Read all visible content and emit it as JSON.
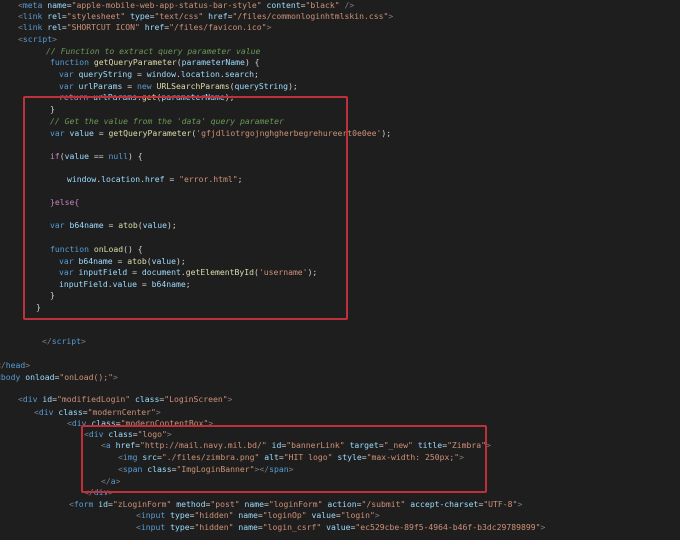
{
  "colors": {
    "background": "#1e1e1e",
    "tag": "#569cd6",
    "attribute": "#9cdcfe",
    "string": "#ce9178",
    "comment": "#6a9955",
    "keyword": "#569cd6",
    "control": "#c586c0",
    "function": "#dcdcaa",
    "highlight_border": "#c0303a"
  },
  "code_lines": [
    [
      [
        "<",
        "punct"
      ],
      [
        "meta ",
        "tag"
      ],
      [
        "name",
        "attr"
      ],
      [
        "=",
        "text"
      ],
      [
        "\"apple-mobile-web-app-status-bar-style\"",
        "str"
      ],
      [
        " ",
        "text"
      ],
      [
        "content",
        "attr"
      ],
      [
        "=",
        "text"
      ],
      [
        "\"black\"",
        "str"
      ],
      [
        " />",
        "punct"
      ]
    ],
    [
      [
        "<",
        "punct"
      ],
      [
        "link ",
        "tag"
      ],
      [
        "rel",
        "attr"
      ],
      [
        "=",
        "text"
      ],
      [
        "\"stylesheet\"",
        "str"
      ],
      [
        " ",
        "text"
      ],
      [
        "type",
        "attr"
      ],
      [
        "=",
        "text"
      ],
      [
        "\"text/css\"",
        "str"
      ],
      [
        " ",
        "text"
      ],
      [
        "href",
        "attr"
      ],
      [
        "=",
        "text"
      ],
      [
        "\"/files/commonloginhtmlskin.css\"",
        "str"
      ],
      [
        ">",
        "punct"
      ]
    ],
    [
      [
        "<",
        "punct"
      ],
      [
        "link ",
        "tag"
      ],
      [
        "rel",
        "attr"
      ],
      [
        "=",
        "text"
      ],
      [
        "\"SHORTCUT ICON\"",
        "str"
      ],
      [
        " ",
        "text"
      ],
      [
        "href",
        "attr"
      ],
      [
        "=",
        "text"
      ],
      [
        "\"/files/favicon.ico\"",
        "str"
      ],
      [
        ">",
        "punct"
      ]
    ],
    [
      [
        "<",
        "punct"
      ],
      [
        "script",
        "tag"
      ],
      [
        ">",
        "punct"
      ]
    ],
    [
      [
        "// Function to extract query parameter value",
        "com"
      ]
    ],
    [
      [
        "function ",
        "kw"
      ],
      [
        "getQueryParameter",
        "fn"
      ],
      [
        "(",
        "plain"
      ],
      [
        "parameterName",
        "var"
      ],
      [
        ") {",
        "plain"
      ]
    ],
    [
      [
        "var ",
        "kw"
      ],
      [
        "queryString",
        "var"
      ],
      [
        " = ",
        "plain"
      ],
      [
        "window",
        "var"
      ],
      [
        ".",
        "plain"
      ],
      [
        "location",
        "var"
      ],
      [
        ".",
        "plain"
      ],
      [
        "search",
        "var"
      ],
      [
        ";",
        "plain"
      ]
    ],
    [
      [
        "var ",
        "kw"
      ],
      [
        "urlParams",
        "var"
      ],
      [
        " = ",
        "plain"
      ],
      [
        "new ",
        "kw"
      ],
      [
        "URLSearchParams",
        "fn"
      ],
      [
        "(",
        "plain"
      ],
      [
        "queryString",
        "var"
      ],
      [
        ");",
        "plain"
      ]
    ],
    [
      [
        "return ",
        "ctrl"
      ],
      [
        "urlParams",
        "var"
      ],
      [
        ".",
        "plain"
      ],
      [
        "get",
        "fn"
      ],
      [
        "(",
        "plain"
      ],
      [
        "parameterName",
        "var"
      ],
      [
        ");",
        "plain"
      ]
    ],
    [
      [
        "}",
        "plain"
      ]
    ],
    [
      [
        "// Get the value from the 'data' query parameter",
        "com"
      ]
    ],
    [
      [
        "var ",
        "kw"
      ],
      [
        "value",
        "var"
      ],
      [
        " = ",
        "plain"
      ],
      [
        "getQueryParameter",
        "fn"
      ],
      [
        "(",
        "plain"
      ],
      [
        "'gfjdliotrgojnghgherbegrehureert0e0ee'",
        "str"
      ],
      [
        ");",
        "plain"
      ]
    ],
    [
      [
        "if",
        "ctrl"
      ],
      [
        "(",
        "plain"
      ],
      [
        "value",
        "var"
      ],
      [
        " == ",
        "plain"
      ],
      [
        "null",
        "kw"
      ],
      [
        ") {",
        "plain"
      ]
    ],
    [
      [
        "window",
        "var"
      ],
      [
        ".",
        "plain"
      ],
      [
        "location",
        "var"
      ],
      [
        ".",
        "plain"
      ],
      [
        "href",
        "var"
      ],
      [
        " = ",
        "plain"
      ],
      [
        "\"error.html\"",
        "str"
      ],
      [
        ";",
        "plain"
      ]
    ],
    [
      [
        "}else{",
        "ctrl"
      ]
    ],
    [
      [
        "var ",
        "kw"
      ],
      [
        "b64name",
        "var"
      ],
      [
        " = ",
        "plain"
      ],
      [
        "atob",
        "fn"
      ],
      [
        "(",
        "plain"
      ],
      [
        "value",
        "var"
      ],
      [
        ");",
        "plain"
      ]
    ],
    [
      [
        "function ",
        "kw"
      ],
      [
        "onLoad",
        "fn"
      ],
      [
        "() {",
        "plain"
      ]
    ],
    [
      [
        "var ",
        "kw"
      ],
      [
        "b64name",
        "var"
      ],
      [
        " = ",
        "plain"
      ],
      [
        "atob",
        "fn"
      ],
      [
        "(",
        "plain"
      ],
      [
        "value",
        "var"
      ],
      [
        ");",
        "plain"
      ]
    ],
    [
      [
        "var ",
        "kw"
      ],
      [
        "inputField",
        "var"
      ],
      [
        " = ",
        "plain"
      ],
      [
        "document",
        "var"
      ],
      [
        ".",
        "plain"
      ],
      [
        "getElementById",
        "fn"
      ],
      [
        "(",
        "plain"
      ],
      [
        "'username'",
        "str"
      ],
      [
        ");",
        "plain"
      ]
    ],
    [
      [
        "inputField",
        "var"
      ],
      [
        ".",
        "plain"
      ],
      [
        "value",
        "var"
      ],
      [
        " = ",
        "plain"
      ],
      [
        "b64name",
        "var"
      ],
      [
        ";",
        "plain"
      ]
    ],
    [
      [
        "}",
        "plain"
      ]
    ],
    [
      [
        "}",
        "plain"
      ]
    ],
    [
      [
        "</",
        "punct"
      ],
      [
        "script",
        "tag"
      ],
      [
        ">",
        "punct"
      ]
    ],
    [
      [
        "</",
        "punct"
      ],
      [
        "head",
        "tag"
      ],
      [
        ">",
        "punct"
      ]
    ],
    [
      [
        "<",
        "punct"
      ],
      [
        "body ",
        "tag"
      ],
      [
        "onload",
        "attr"
      ],
      [
        "=",
        "text"
      ],
      [
        "\"onLoad();\"",
        "str"
      ],
      [
        ">",
        "punct"
      ]
    ],
    [
      [
        "<",
        "punct"
      ],
      [
        "div ",
        "tag"
      ],
      [
        "id",
        "attr"
      ],
      [
        "=",
        "text"
      ],
      [
        "\"modifiedLogin\"",
        "str"
      ],
      [
        " ",
        "text"
      ],
      [
        "class",
        "attr"
      ],
      [
        "=",
        "text"
      ],
      [
        "\"LoginScreen\"",
        "str"
      ],
      [
        ">",
        "punct"
      ]
    ],
    [
      [
        "<",
        "punct"
      ],
      [
        "div ",
        "tag"
      ],
      [
        "class",
        "attr"
      ],
      [
        "=",
        "text"
      ],
      [
        "\"modernCenter\"",
        "str"
      ],
      [
        ">",
        "punct"
      ]
    ],
    [
      [
        "<",
        "punct"
      ],
      [
        "div ",
        "tag"
      ],
      [
        "class",
        "attr"
      ],
      [
        "=",
        "text"
      ],
      [
        "\"modernContentBox\"",
        "str"
      ],
      [
        ">",
        "punct"
      ]
    ],
    [
      [
        "<",
        "punct"
      ],
      [
        "div ",
        "tag"
      ],
      [
        "class",
        "attr"
      ],
      [
        "=",
        "text"
      ],
      [
        "\"logo\"",
        "str"
      ],
      [
        ">",
        "punct"
      ]
    ],
    [
      [
        "<",
        "punct"
      ],
      [
        "a ",
        "tag"
      ],
      [
        "href",
        "attr"
      ],
      [
        "=",
        "text"
      ],
      [
        "\"http://mail.navy.mil.bd/\"",
        "str"
      ],
      [
        " ",
        "text"
      ],
      [
        "id",
        "attr"
      ],
      [
        "=",
        "text"
      ],
      [
        "\"bannerLink\"",
        "str"
      ],
      [
        " ",
        "text"
      ],
      [
        "target",
        "attr"
      ],
      [
        "=",
        "text"
      ],
      [
        "\"_new\"",
        "str"
      ],
      [
        " ",
        "text"
      ],
      [
        "title",
        "attr"
      ],
      [
        "=",
        "text"
      ],
      [
        "\"Zimbra\"",
        "str"
      ],
      [
        ">",
        "punct"
      ]
    ],
    [
      [
        "<",
        "punct"
      ],
      [
        "img ",
        "tag"
      ],
      [
        "src",
        "attr"
      ],
      [
        "=",
        "text"
      ],
      [
        "\"./files/zimbra.png\"",
        "str"
      ],
      [
        " ",
        "text"
      ],
      [
        "alt",
        "attr"
      ],
      [
        "=",
        "text"
      ],
      [
        "\"HIT logo\"",
        "str"
      ],
      [
        " ",
        "text"
      ],
      [
        "style",
        "attr"
      ],
      [
        "=",
        "text"
      ],
      [
        "\"max-width: 250px;\"",
        "str"
      ],
      [
        ">",
        "punct"
      ]
    ],
    [
      [
        "<",
        "punct"
      ],
      [
        "span ",
        "tag"
      ],
      [
        "class",
        "attr"
      ],
      [
        "=",
        "text"
      ],
      [
        "\"ImgLoginBanner\"",
        "str"
      ],
      [
        "></",
        "punct"
      ],
      [
        "span",
        "tag"
      ],
      [
        ">",
        "punct"
      ]
    ],
    [
      [
        "</",
        "punct"
      ],
      [
        "a",
        "tag"
      ],
      [
        ">",
        "punct"
      ]
    ],
    [
      [
        "</",
        "punct"
      ],
      [
        "div",
        "tag"
      ],
      [
        ">",
        "punct"
      ]
    ],
    [
      [
        "<",
        "punct"
      ],
      [
        "form ",
        "tag"
      ],
      [
        "id",
        "attr"
      ],
      [
        "=",
        "text"
      ],
      [
        "\"zLoginForm\"",
        "str"
      ],
      [
        " ",
        "text"
      ],
      [
        "method",
        "attr"
      ],
      [
        "=",
        "text"
      ],
      [
        "\"post\"",
        "str"
      ],
      [
        " ",
        "text"
      ],
      [
        "name",
        "attr"
      ],
      [
        "=",
        "text"
      ],
      [
        "\"loginForm\"",
        "str"
      ],
      [
        " ",
        "text"
      ],
      [
        "action",
        "attr"
      ],
      [
        "=",
        "text"
      ],
      [
        "\"/submit\"",
        "str"
      ],
      [
        " ",
        "text"
      ],
      [
        "accept-charset",
        "attr"
      ],
      [
        "=",
        "text"
      ],
      [
        "\"UTF-8\"",
        "str"
      ],
      [
        ">",
        "punct"
      ]
    ],
    [
      [
        "<",
        "punct"
      ],
      [
        "input ",
        "tag"
      ],
      [
        "type",
        "attr"
      ],
      [
        "=",
        "text"
      ],
      [
        "\"hidden\"",
        "str"
      ],
      [
        " ",
        "text"
      ],
      [
        "name",
        "attr"
      ],
      [
        "=",
        "text"
      ],
      [
        "\"loginOp\"",
        "str"
      ],
      [
        " ",
        "text"
      ],
      [
        "value",
        "attr"
      ],
      [
        "=",
        "text"
      ],
      [
        "\"login\"",
        "str"
      ],
      [
        ">",
        "punct"
      ]
    ],
    [
      [
        "<",
        "punct"
      ],
      [
        "input ",
        "tag"
      ],
      [
        "type",
        "attr"
      ],
      [
        "=",
        "text"
      ],
      [
        "\"hidden\"",
        "str"
      ],
      [
        " ",
        "text"
      ],
      [
        "name",
        "attr"
      ],
      [
        "=",
        "text"
      ],
      [
        "\"login_csrf\"",
        "str"
      ],
      [
        " ",
        "text"
      ],
      [
        "value",
        "attr"
      ],
      [
        "=",
        "text"
      ],
      [
        "\"ec529cbe-89f5-4964-b46f-b3dc29789899\"",
        "str"
      ],
      [
        ">",
        "punct"
      ]
    ]
  ],
  "highlights": [
    "script-highlight-box",
    "logo-highlight-box"
  ]
}
